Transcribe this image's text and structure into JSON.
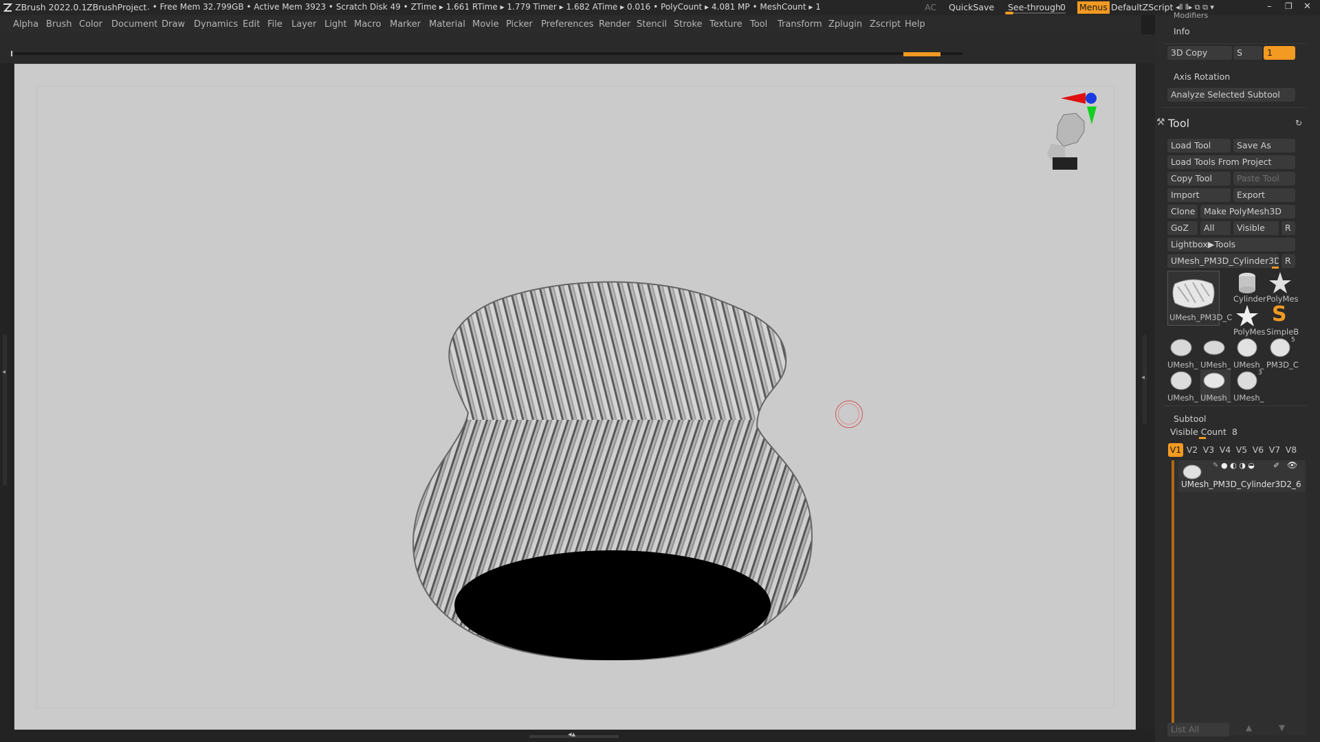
{
  "titlebar": {
    "app": "ZBrush 2022.0.1",
    "project": "ZBrushProject",
    "stats": ". • Free Mem 32.799GB • Active Mem 3923 • Scratch Disk 49 • ZTime ▸ 1.661 RTime ▸ 1.779 Timer ▸ 1.682 ATime ▸ 0.016 • PolyCount ▸ 4.081 MP • MeshCount ▸ 1",
    "ac": "AC",
    "quicksave": "QuickSave",
    "seethrough": "See-through",
    "seethrough_value": "0",
    "menus": "Menus",
    "script": "DefaultZScript"
  },
  "menubar": {
    "items": [
      "Alpha",
      "Brush",
      "Color",
      "Document",
      "Draw",
      "Dynamics",
      "Edit",
      "File",
      "Layer",
      "Light",
      "Macro",
      "Marker",
      "Material",
      "Movie",
      "Picker",
      "Preferences",
      "Render",
      "Stencil",
      "Stroke",
      "Texture",
      "Tool",
      "Transform",
      "Zplugin",
      "Zscript",
      "Help"
    ]
  },
  "rpanel": {
    "modifiers": "Modifiers",
    "info": "Info",
    "copy3d": "3D Copy",
    "s_label": "S",
    "s_value": "1",
    "axis_rotation": "Axis Rotation",
    "analyze": "Analyze Selected Subtool",
    "tool_title": "Tool",
    "load_tool": "Load Tool",
    "save_as": "Save As",
    "load_from_project": "Load Tools From Project",
    "copy_tool": "Copy Tool",
    "paste_tool": "Paste Tool",
    "import": "Import",
    "export": "Export",
    "clone": "Clone",
    "make_polymesh": "Make PolyMesh3D",
    "goz": "GoZ",
    "all": "All",
    "visible": "Visible",
    "r": "R",
    "lightbox": "Lightbox▶Tools",
    "current_tool": "UMesh_PM3D_Cylinder3D2_6",
    "thumbs": {
      "main": "UMesh_PM3D_C",
      "cylinder": "Cylinder",
      "polymesh1": "PolyMes",
      "polymesh2": "PolyMes",
      "simpleb": "SimpleB",
      "t1": "UMesh_",
      "t2": "UMesh_",
      "t3": "UMesh_",
      "t4": "PM3D_C",
      "t5": "UMesh_",
      "t6": "UMesh_",
      "t7": "UMesh_",
      "t4_badge": "5",
      "t7_badge": "3"
    },
    "subtool_title": "Subtool",
    "visible_count_label": "Visible Count",
    "visible_count": "8",
    "vtabs": [
      "V1",
      "V2",
      "V3",
      "V4",
      "V5",
      "V6",
      "V7",
      "V8"
    ],
    "subtool_name": "UMesh_PM3D_Cylinder3D2_6",
    "list_all": "List All"
  },
  "colors": {
    "accent": "#f29a22",
    "canvas": "#cbcbcb",
    "panel": "#2b2b2b"
  }
}
